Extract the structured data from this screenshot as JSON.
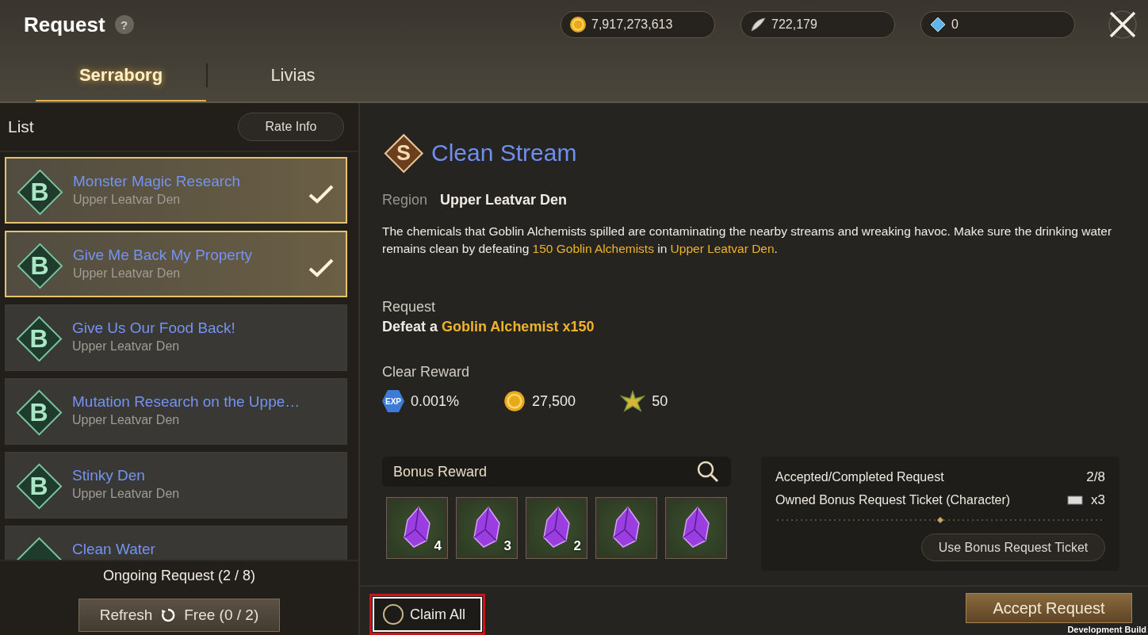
{
  "window": {
    "title": "Request",
    "help": "?"
  },
  "currencies": [
    {
      "kind": "gold",
      "amount": "7,917,273,613"
    },
    {
      "kind": "feather",
      "amount": "722,179"
    },
    {
      "kind": "gem",
      "amount": "0"
    }
  ],
  "tabs": [
    {
      "label": "Serraborg",
      "selected": true
    },
    {
      "label": "Livias",
      "selected": false
    }
  ],
  "list": {
    "title": "List",
    "rate_button": "Rate Info",
    "items": [
      {
        "grade": "B",
        "title": "Monster Magic Research",
        "region": "Upper Leatvar Den",
        "selected": true
      },
      {
        "grade": "B",
        "title": "Give Me Back My Property",
        "region": "Upper Leatvar Den",
        "selected": true
      },
      {
        "grade": "B",
        "title": "Give Us Our Food Back!",
        "region": "Upper Leatvar Den",
        "selected": false
      },
      {
        "grade": "B",
        "title": "Mutation Research on the Uppe…",
        "region": "Upper Leatvar Den",
        "selected": false
      },
      {
        "grade": "B",
        "title": "Stinky Den",
        "region": "Upper Leatvar Den",
        "selected": false
      },
      {
        "title": "Clean Water",
        "selected": false
      }
    ],
    "ongoing": "Ongoing Request (2 / 8)",
    "refresh": {
      "label": "Refresh",
      "free": "Free (0 / 2)"
    }
  },
  "detail": {
    "grade": "S",
    "title": "Clean Stream",
    "region_label": "Region",
    "region": "Upper Leatvar Den",
    "description": [
      {
        "text": "The chemicals that Goblin Alchemists spilled are contaminating the nearby streams and wreaking havoc. Make sure the drinking water remains clean by defeating ",
        "highlight": false
      },
      {
        "text": "150 Goblin Alchemists",
        "highlight": true
      },
      {
        "text": " in ",
        "highlight": false
      },
      {
        "text": "Upper Leatvar Den",
        "highlight": true
      },
      {
        "text": ".",
        "highlight": false
      }
    ],
    "request_label": "Request",
    "request": [
      {
        "text": "Defeat a ",
        "highlight": false
      },
      {
        "text": "Goblin Alchemist x150",
        "highlight": true
      }
    ],
    "clear_reward_label": "Clear Reward",
    "clear_rewards": [
      {
        "kind": "exp",
        "badge": "EXP",
        "value": "0.001%"
      },
      {
        "kind": "gold",
        "value": "27,500"
      },
      {
        "kind": "emblem",
        "value": "50"
      }
    ],
    "bonus_reward_label": "Bonus Reward",
    "bonus_items": [
      {
        "kind": "crystal",
        "count": "4"
      },
      {
        "kind": "crystal",
        "count": "3"
      },
      {
        "kind": "crystal",
        "count": "2"
      },
      {
        "kind": "crystal"
      },
      {
        "kind": "crystal"
      }
    ],
    "stats": [
      {
        "label": "Accepted/Completed Request",
        "value": "2/8",
        "ticket": false
      },
      {
        "label": "Owned Bonus Request Ticket (Character)",
        "value": "x3",
        "ticket": true
      }
    ],
    "use_ticket_button": "Use Bonus Request Ticket"
  },
  "claim_all": {
    "label": "Claim All",
    "checked": false
  },
  "accept_button": "Accept Request",
  "build_label": "Development Build"
}
